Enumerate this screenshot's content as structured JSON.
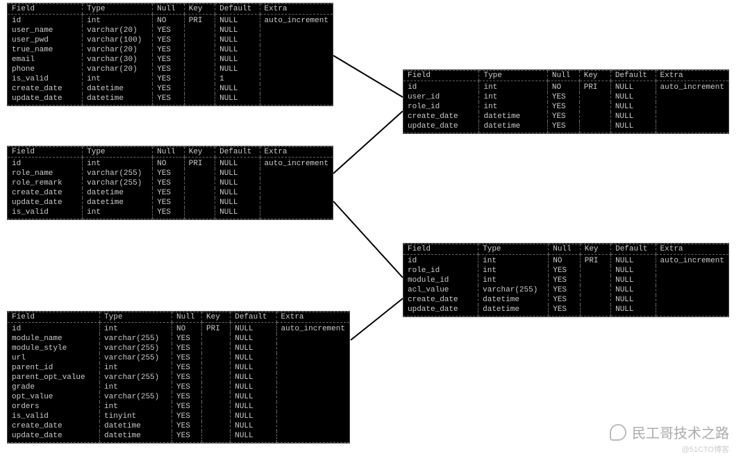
{
  "headers": [
    "Field",
    "Type",
    "Null",
    "Key",
    "Default",
    "Extra"
  ],
  "tables": {
    "t1": {
      "rows": [
        [
          "id",
          "int",
          "NO",
          "PRI",
          "NULL",
          "auto_increment"
        ],
        [
          "user_name",
          "varchar(20)",
          "YES",
          "",
          "NULL",
          ""
        ],
        [
          "user_pwd",
          "varchar(100)",
          "YES",
          "",
          "NULL",
          ""
        ],
        [
          "true_name",
          "varchar(20)",
          "YES",
          "",
          "NULL",
          ""
        ],
        [
          "email",
          "varchar(30)",
          "YES",
          "",
          "NULL",
          ""
        ],
        [
          "phone",
          "varchar(20)",
          "YES",
          "",
          "NULL",
          ""
        ],
        [
          "is_valid",
          "int",
          "YES",
          "",
          "1",
          ""
        ],
        [
          "create_date",
          "datetime",
          "YES",
          "",
          "NULL",
          ""
        ],
        [
          "update_date",
          "datetime",
          "YES",
          "",
          "NULL",
          ""
        ]
      ]
    },
    "t2": {
      "rows": [
        [
          "id",
          "int",
          "NO",
          "PRI",
          "NULL",
          "auto_increment"
        ],
        [
          "role_name",
          "varchar(255)",
          "YES",
          "",
          "NULL",
          ""
        ],
        [
          "role_remark",
          "varchar(255)",
          "YES",
          "",
          "NULL",
          ""
        ],
        [
          "create_date",
          "datetime",
          "YES",
          "",
          "NULL",
          ""
        ],
        [
          "update_date",
          "datetime",
          "YES",
          "",
          "NULL",
          ""
        ],
        [
          "is_valid",
          "int",
          "YES",
          "",
          "NULL",
          ""
        ]
      ]
    },
    "t3": {
      "rows": [
        [
          "id",
          "int",
          "NO",
          "PRI",
          "NULL",
          "auto_increment"
        ],
        [
          "module_name",
          "varchar(255)",
          "YES",
          "",
          "NULL",
          ""
        ],
        [
          "module_style",
          "varchar(255)",
          "YES",
          "",
          "NULL",
          ""
        ],
        [
          "url",
          "varchar(255)",
          "YES",
          "",
          "NULL",
          ""
        ],
        [
          "parent_id",
          "int",
          "YES",
          "",
          "NULL",
          ""
        ],
        [
          "parent_opt_value",
          "varchar(255)",
          "YES",
          "",
          "NULL",
          ""
        ],
        [
          "grade",
          "int",
          "YES",
          "",
          "NULL",
          ""
        ],
        [
          "opt_value",
          "varchar(255)",
          "YES",
          "",
          "NULL",
          ""
        ],
        [
          "orders",
          "int",
          "YES",
          "",
          "NULL",
          ""
        ],
        [
          "is_valid",
          "tinyint",
          "YES",
          "",
          "NULL",
          ""
        ],
        [
          "create_date",
          "datetime",
          "YES",
          "",
          "NULL",
          ""
        ],
        [
          "update_date",
          "datetime",
          "YES",
          "",
          "NULL",
          ""
        ]
      ]
    },
    "t4": {
      "rows": [
        [
          "id",
          "int",
          "NO",
          "PRI",
          "NULL",
          "auto_increment"
        ],
        [
          "user_id",
          "int",
          "YES",
          "",
          "NULL",
          ""
        ],
        [
          "role_id",
          "int",
          "YES",
          "",
          "NULL",
          ""
        ],
        [
          "create_date",
          "datetime",
          "YES",
          "",
          "NULL",
          ""
        ],
        [
          "update_date",
          "datetime",
          "YES",
          "",
          "NULL",
          ""
        ]
      ]
    },
    "t5": {
      "rows": [
        [
          "id",
          "int",
          "NO",
          "PRI",
          "NULL",
          "auto_increment"
        ],
        [
          "role_id",
          "int",
          "YES",
          "",
          "NULL",
          ""
        ],
        [
          "module_id",
          "int",
          "YES",
          "",
          "NULL",
          ""
        ],
        [
          "acl_value",
          "varchar(255)",
          "YES",
          "",
          "NULL",
          ""
        ],
        [
          "create_date",
          "datetime",
          "YES",
          "",
          "NULL",
          ""
        ],
        [
          "update_date",
          "datetime",
          "YES",
          "",
          "NULL",
          ""
        ]
      ]
    }
  },
  "watermark": {
    "main": "民工哥技术之路",
    "sub": "@51CTO博客"
  },
  "colwidths": {
    "default": [
      "24%",
      "22%",
      "10%",
      "10%",
      "14%",
      "20%"
    ],
    "t3": [
      "28%",
      "22%",
      "9%",
      "9%",
      "14%",
      "18%"
    ]
  },
  "connectors": [
    {
      "from": "t1",
      "to": "t4"
    },
    {
      "from": "t2",
      "to": "t4"
    },
    {
      "from": "t2",
      "to": "t5"
    },
    {
      "from": "t3",
      "to": "t5"
    }
  ]
}
